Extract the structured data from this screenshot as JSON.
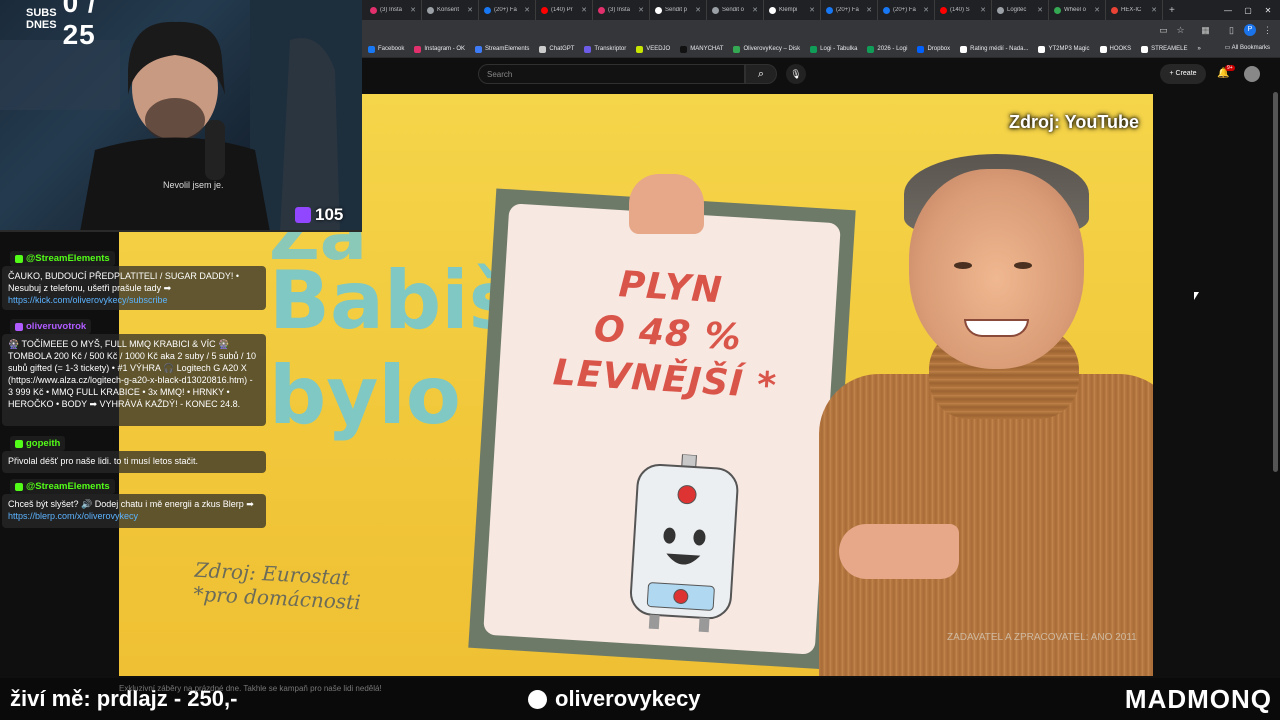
{
  "browser": {
    "tabs": [
      {
        "label": "(3) Insta",
        "color": "#e1306c"
      },
      {
        "label": "Konsent",
        "color": "#9aa0a6"
      },
      {
        "label": "(20+) Fa",
        "color": "#1877f2"
      },
      {
        "label": "(140) Pr",
        "color": "#ff0000"
      },
      {
        "label": "(3) Insta",
        "color": "#e1306c"
      },
      {
        "label": "Sendit p",
        "color": "#ffffff"
      },
      {
        "label": "Sendit o",
        "color": "#9aa0a6"
      },
      {
        "label": "Klempi",
        "color": "#ffffff"
      },
      {
        "label": "(20+) Fa",
        "color": "#1877f2"
      },
      {
        "label": "(20+) Fa",
        "color": "#1877f2"
      },
      {
        "label": "(140) Š",
        "color": "#ff0000"
      },
      {
        "label": "Logitec",
        "color": "#9aa0a6"
      },
      {
        "label": "Wheel o",
        "color": "#34a853"
      },
      {
        "label": "HEX-IC",
        "color": "#ea4335"
      }
    ],
    "new_tab": "+",
    "profile_initial": "P",
    "bookmarks": [
      {
        "label": "Facebook",
        "color": "#1877f2"
      },
      {
        "label": "Instagram - OK",
        "color": "#e1306c"
      },
      {
        "label": "StreamElements",
        "color": "#3d7bf7"
      },
      {
        "label": "ChatGPT",
        "color": "#cccccc"
      },
      {
        "label": "Transkriptor",
        "color": "#6c5ce7"
      },
      {
        "label": "VEEDJO",
        "color": "#c8e600"
      },
      {
        "label": "MANYCHAT",
        "color": "#111111"
      },
      {
        "label": "OliverovyKecy – Disk",
        "color": "#34a853"
      },
      {
        "label": "Logi - Tabulka",
        "color": "#0f9d58"
      },
      {
        "label": "2026 - Logi",
        "color": "#0f9d58"
      },
      {
        "label": "Dropbox",
        "color": "#0061ff"
      },
      {
        "label": "Rating médií - Nada...",
        "color": "#ffffff"
      },
      {
        "label": "YT2MP3 Magic",
        "color": "#ffffff"
      },
      {
        "label": "HOOKS",
        "color": "#ffffff"
      },
      {
        "label": "STREAMELE",
        "color": "#ffffff"
      }
    ],
    "bookmarks_overflow": "»",
    "all_bookmarks": "All Bookmarks"
  },
  "youtube": {
    "search_placeholder": "Search",
    "create_label": "Create",
    "notif_count": "9+"
  },
  "video": {
    "source_label": "Zdroj: YouTube",
    "bg_line1": "Za",
    "bg_line2": "Babiše",
    "bg_line3": "bylo líp!",
    "poster_line1": "PLYN",
    "poster_line2": "O 48 %",
    "poster_line3": "LEVNĚJŠÍ *",
    "eurostat_line1": "Zdroj: Eurostat",
    "eurostat_line2": "*pro domácnosti",
    "watermark": "ZADAVATEL A ZPRACOVATEL: ANO 2011"
  },
  "stream": {
    "subs_label_line1": "SUBS",
    "subs_label_line2": "DNES",
    "subs_count": "0 / 25",
    "viewers": "105",
    "webcam_shirt": "Nevolil jsem je.",
    "chat": [
      {
        "name": "@StreamElements",
        "name_color": "#53fc18",
        "text": "ČAUKO, BUDOUCÍ PŘEDPLATITELI / SUGAR DADDY! • Nesubuj z telefonu, ušetři prašule tady ➡",
        "link": "https://kick.com/oliverovykecy/subscribe"
      },
      {
        "name": "oliveruvotrok",
        "name_color": "#b05cff",
        "text": "🎡 TOČÍMEEE O MYŠ, FULL MMQ KRABICI & VÍC 🎡 TOMBOLA 200 Kč / 500 Kč / 1000 Kč aka 2 suby / 5 subů / 10 subů gifted (= 1-3 tickety) • #1 VÝHRA 🎧 Logitech G A20 X (https://www.alza.cz/logitech-g-a20-x-black-d13020816.htm) - 3 999 Kč • MMQ FULL KRABICE • 3x MMQ! • HRNKY • HEROČKO • BODY ➡ VYHRÁVÁ KAŽDÝ! - KONEC 24.8.",
        "link": ""
      },
      {
        "name": "gopeith",
        "name_color": "#53fc18",
        "text": "Přivolal déšť pro naše lidi. to ti musí letos stačit.",
        "link": ""
      },
      {
        "name": "@StreamElements",
        "name_color": "#53fc18",
        "text": "Chceš být slyšet? 🔊 Dodej chatu i mě energii a zkus Blerp ➡",
        "link": "https://blerp.com/x/oliverovykecy"
      }
    ],
    "bottom_left": "živí mě: prdlajz - 250,-",
    "bottom_center": "oliverovykecy",
    "bottom_right": "MADMONQ",
    "ticker": "Exkluzivní záběry na prázdné dne. Takhle se kampaň pro naše lidi nedělá!"
  }
}
